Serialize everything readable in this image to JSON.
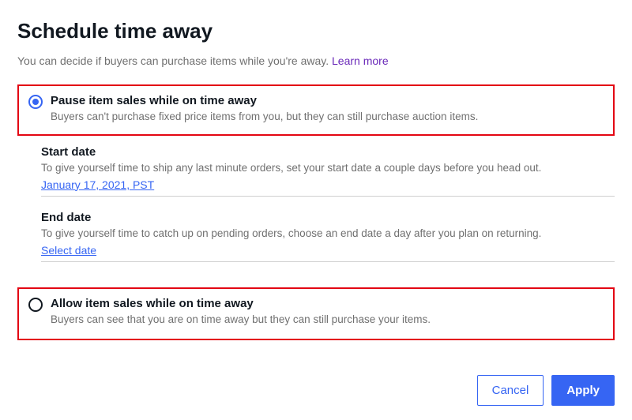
{
  "title": "Schedule time away",
  "subtitle_prefix": "You can decide if buyers can purchase items while you're away. ",
  "learn_more": "Learn more",
  "options": {
    "pause": {
      "label": "Pause item sales while on time away",
      "desc": "Buyers can't purchase fixed price items from you, but they can still purchase auction items."
    },
    "allow": {
      "label": "Allow item sales while on time away",
      "desc": "Buyers can see that you are on time away but they can still purchase your items."
    }
  },
  "start_date": {
    "label": "Start date",
    "desc": "To give yourself time to ship any last minute orders, set your start date a couple days before you head out.",
    "value": "January 17, 2021, PST"
  },
  "end_date": {
    "label": "End date",
    "desc": "To give yourself time to catch up on pending orders, choose an end date a day after you plan on returning.",
    "value": "Select date"
  },
  "buttons": {
    "cancel": "Cancel",
    "apply": "Apply"
  }
}
